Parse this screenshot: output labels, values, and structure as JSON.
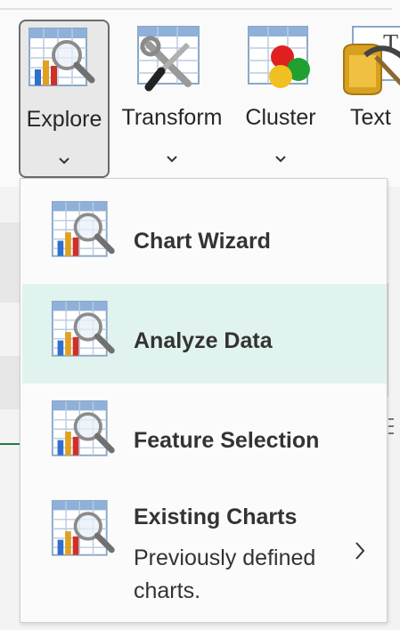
{
  "ribbon": {
    "buttons": [
      {
        "label": "Explore",
        "icon": "chart-magnifier-icon",
        "state": "pressed"
      },
      {
        "label": "Transform",
        "icon": "tools-icon"
      },
      {
        "label": "Cluster",
        "icon": "cluster-icon"
      },
      {
        "label": "Text",
        "icon": "text-mining-icon"
      }
    ]
  },
  "menu": {
    "items": [
      {
        "title": "Chart Wizard",
        "icon": "chart-magnifier-icon"
      },
      {
        "title": "Analyze Data",
        "icon": "chart-magnifier-icon",
        "state": "hover"
      },
      {
        "title": "Feature Selection",
        "icon": "chart-magnifier-icon"
      },
      {
        "title": "Existing Charts",
        "description": "Previously defined charts.",
        "icon": "chart-magnifier-icon",
        "submenu_icon": "chevron-right-icon"
      }
    ]
  },
  "colors": {
    "hover_background": "#e1f3ef",
    "pressed_background": "#e8e8e8",
    "text": "#262626"
  }
}
